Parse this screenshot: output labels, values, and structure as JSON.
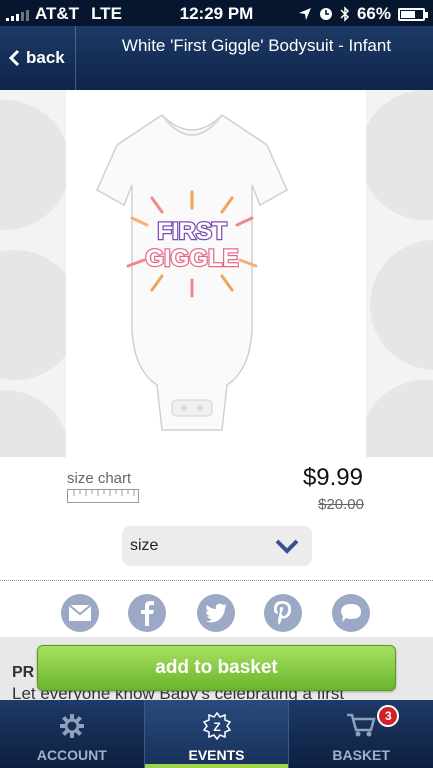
{
  "status_bar": {
    "carrier": "AT&T",
    "network": "LTE",
    "time": "12:29 PM",
    "battery": "66%",
    "battery_level": 0.66
  },
  "nav": {
    "back_label": "back",
    "title": "White 'First Giggle' Bodysuit - Infant"
  },
  "product": {
    "graphic_text_line1": "FIRST",
    "graphic_text_line2": "GIGGLE",
    "size_chart_label": "size chart",
    "price": "$9.99",
    "old_price": "$20.00",
    "size_select_value": "size"
  },
  "social": [
    "email-icon",
    "facebook-icon",
    "twitter-icon",
    "pinterest-icon",
    "chat-icon"
  ],
  "description": {
    "heading_partial": "PR",
    "text_partial": "Let everyone know Baby's celebrating a first"
  },
  "add_to_basket_label": "add to basket",
  "tabs": [
    {
      "label": "ACCOUNT",
      "icon": "gear-icon"
    },
    {
      "label": "EVENTS",
      "icon": "z-badge-icon"
    },
    {
      "label": "BASKET",
      "icon": "cart-icon",
      "badge": "3"
    }
  ],
  "colors": {
    "nav_bg": "#1d3a66",
    "accent_green": "#7cc23a",
    "social_icon": "#9ba8c6",
    "badge_red": "#d3202a"
  }
}
